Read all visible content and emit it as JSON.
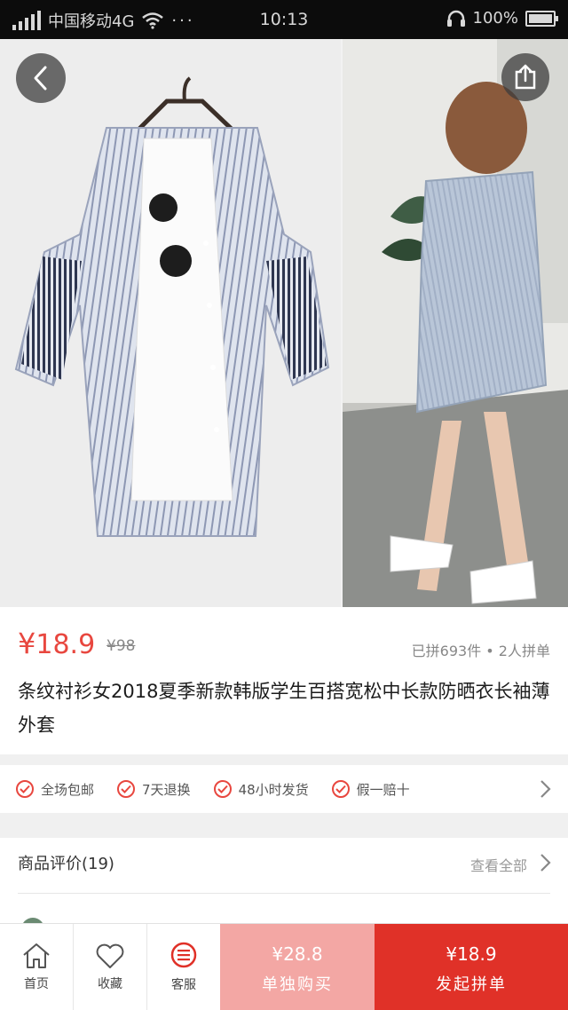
{
  "status_bar": {
    "carrier": "中国移动4G",
    "time": "10:13",
    "battery": "100%",
    "more": "···"
  },
  "product": {
    "price_symbol": "¥",
    "price": "18.9",
    "original_price": "¥98",
    "sales_info": "已拼693件 • 2人拼单",
    "title": "条纹衬衫女2018夏季新款韩版学生百搭宽松中长款防晒衣长袖薄外套"
  },
  "services": {
    "items": [
      {
        "label": "全场包邮"
      },
      {
        "label": "7天退换"
      },
      {
        "label": "48小时发货"
      },
      {
        "label": "假一赔十"
      }
    ]
  },
  "reviews": {
    "label": "商品评价(19)",
    "see_all": "查看全部"
  },
  "bottom_bar": {
    "home": "首页",
    "favorite": "收藏",
    "service": "客服",
    "buy_alone": {
      "price": "¥28.8",
      "label": "单独购买"
    },
    "group_buy": {
      "price": "¥18.9",
      "label": "发起拼单"
    }
  },
  "colors": {
    "accent": "#e8473f",
    "buy_alone_bg": "#f3a7a4",
    "group_buy_bg": "#e03128"
  }
}
